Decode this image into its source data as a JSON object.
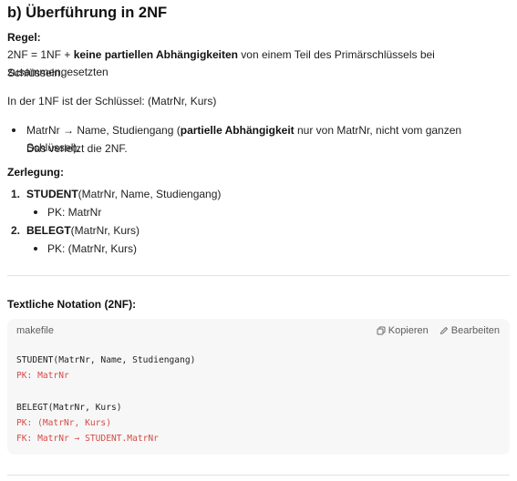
{
  "heading": "b) Überführung in 2NF",
  "rule": {
    "label": "Regel:",
    "prefix": "2NF = 1NF + ",
    "bold": "keine partiellen Abhängigkeiten",
    "suffix": " von einem Teil des Primärschlüssels bei zusammengesetzten",
    "line2": "Schlüsseln."
  },
  "key_line": "In der 1NF ist der Schlüssel: (MatrNr, Kurs)",
  "bullet": {
    "prefix": "MatrNr → Name, Studiengang (",
    "bold": "partielle Abhängigkeit",
    "suffix": " nur von MatrNr, nicht vom ganzen Schlüssel).",
    "line2": "Das verletzt die 2NF."
  },
  "decomposition": {
    "label": "Zerlegung:",
    "items": [
      {
        "number": "1.",
        "name": "STUDENT",
        "attrs": "(MatrNr, Name, Studiengang)",
        "pk": "PK: MatrNr"
      },
      {
        "number": "2.",
        "name": "BELEGT",
        "attrs": "(MatrNr, Kurs)",
        "pk": "PK: (MatrNr, Kurs)"
      }
    ]
  },
  "notation_heading": "Textliche Notation (2NF):",
  "code": {
    "language": "makefile",
    "copy_label": "Kopieren",
    "edit_label": "Bearbeiten",
    "lines": [
      "STUDENT(MatrNr, Name, Studiengang)",
      "PK: MatrNr",
      "BELEGT(MatrNr, Kurs)",
      "PK: (MatrNr, Kurs)",
      "FK: MatrNr → STUDENT.MatrNr"
    ],
    "highlight_color": "#d44c47"
  }
}
